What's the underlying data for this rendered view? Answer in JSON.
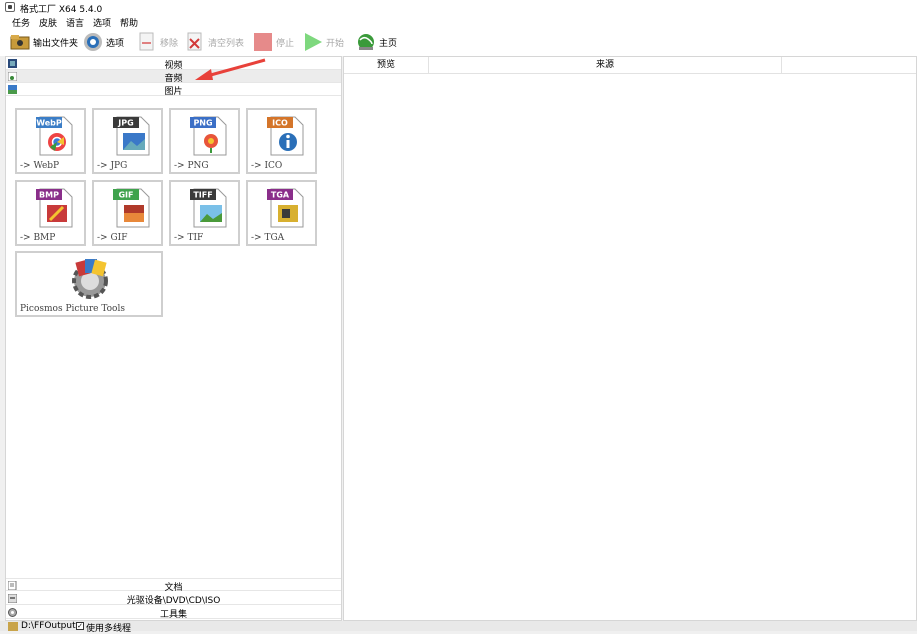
{
  "window": {
    "title": "格式工厂 X64 5.4.0"
  },
  "menu": [
    "任务",
    "皮肤",
    "语言",
    "选项",
    "帮助"
  ],
  "toolbar": {
    "output_folder": "输出文件夹",
    "options": "选项",
    "remove": "移除",
    "clear_list": "清空列表",
    "stop": "停止",
    "start": "开始",
    "home": "主页"
  },
  "categories": {
    "video": "视频",
    "audio": "音频",
    "image": "图片",
    "document": "文档",
    "disc": "光驱设备\\DVD\\CD\\ISO",
    "toolbox": "工具集"
  },
  "tiles": [
    {
      "badge": "WebP",
      "label": "-> WebP",
      "badge_color": "#3b7dc6"
    },
    {
      "badge": "JPG",
      "label": "-> JPG",
      "badge_color": "#3a3a3a"
    },
    {
      "badge": "PNG",
      "label": "-> PNG",
      "badge_color": "#3b6fc6"
    },
    {
      "badge": "ICO",
      "label": "-> ICO",
      "badge_color": "#d4752a"
    },
    {
      "badge": "BMP",
      "label": "-> BMP",
      "badge_color": "#8a2e8a"
    },
    {
      "badge": "GIF",
      "label": "-> GIF",
      "badge_color": "#3fa34d"
    },
    {
      "badge": "TIFF",
      "label": "-> TIF",
      "badge_color": "#3a3a3a"
    },
    {
      "badge": "TGA",
      "label": "-> TGA",
      "badge_color": "#8a2e8a"
    }
  ],
  "picosmos": {
    "label": "Picosmos Picture Tools"
  },
  "table": {
    "col_preview": "预览",
    "col_source": "来源"
  },
  "status": {
    "output_path": "D:\\FFOutput",
    "multithread": "使用多线程"
  },
  "colors": {
    "accent_arrow": "#e8413a",
    "stop_red": "#e68a8a",
    "start_green": "#7ed87e"
  }
}
